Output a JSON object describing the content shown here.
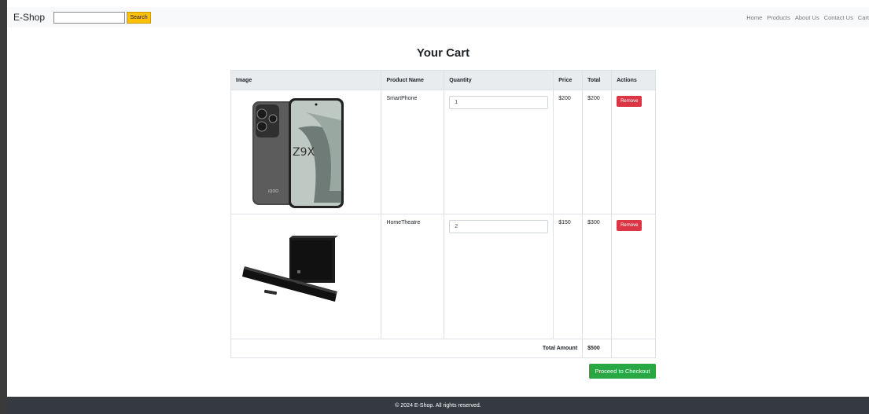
{
  "brand": "E-Shop",
  "search": {
    "placeholder": "",
    "value": "",
    "button_label": "Search"
  },
  "nav": [
    "Home",
    "Products",
    "About Us",
    "Contact Us",
    "Cart"
  ],
  "title": "Your Cart",
  "table": {
    "headers": [
      "Image",
      "Product Name",
      "Quantity",
      "Price",
      "Total",
      "Actions"
    ],
    "rows": [
      {
        "name": "SmartPhone",
        "quantity": "1",
        "price": "$200",
        "total": "$200",
        "action": "Remove",
        "image": "smartphone-image",
        "image_text": "Z9X"
      },
      {
        "name": "HomeTheatre",
        "quantity": "2",
        "price": "$150",
        "total": "$300",
        "action": "Remove",
        "image": "home-theatre-image"
      }
    ],
    "total_label": "Total Amount",
    "total_value": "$500"
  },
  "checkout_label": "Proceed to Checkout",
  "footer": "© 2024 E-Shop. All rights reserved.",
  "colors": {
    "search_button": "#ffc107",
    "remove_button": "#dc3545",
    "checkout_button": "#28a745",
    "footer_bg": "#343a40",
    "navbar_bg": "#f8f9fa"
  }
}
